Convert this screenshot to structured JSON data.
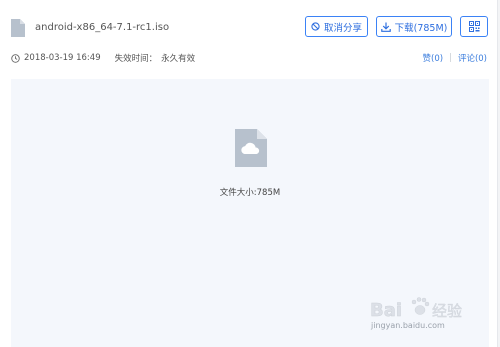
{
  "file": {
    "name": "android-x86_64-7.1-rc1.iso",
    "date": "2018-03-19 16:49",
    "expiry_label": "失效时间：",
    "expiry_value": "永久有效",
    "size_text": "文件大小:785M"
  },
  "toolbar": {
    "cancel_share_label": "取消分享",
    "download_label": "下载(785M)"
  },
  "stats": {
    "likes": "赞(0)",
    "comments": "评论(0)"
  },
  "watermark": {
    "brand": "Bai",
    "brand_cn": "经验",
    "url": "jingyan.baidu.com"
  },
  "colors": {
    "accent": "#2f6fdf",
    "file_icon": "#b7c1cd",
    "preview_bg": "#f4f7fc"
  },
  "icons": {
    "file": "file-icon",
    "cancel": "cancel-share-icon",
    "download": "download-icon",
    "qr": "qr-code-icon",
    "clock": "clock-icon"
  }
}
